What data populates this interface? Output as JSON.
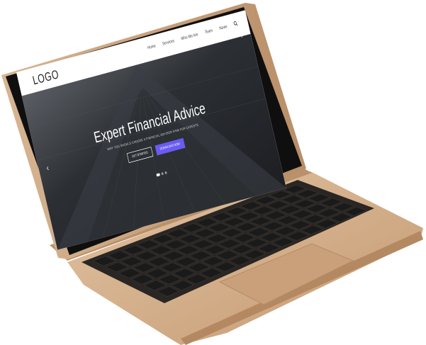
{
  "logo": "LOGO",
  "nav": {
    "items": [
      "Home",
      "Services",
      "Who We Are",
      "Team",
      "News"
    ],
    "search_icon": "search-icon"
  },
  "hero": {
    "title": "Expert Financial Advice",
    "subtitle": "WHY YOU SHOULD CHOOSE A FINANCIAL ADVISOR FIRM FOR EXPERTS",
    "btn_outline": "GET STARTED",
    "btn_primary": "DOWNLOAD NOW",
    "slide_count": 3,
    "active_slide": 1
  },
  "colors": {
    "accent": "#6a5bf2",
    "laptop_body": "#cfa985",
    "bezel": "#111111",
    "keys": "#1d1d1d"
  }
}
